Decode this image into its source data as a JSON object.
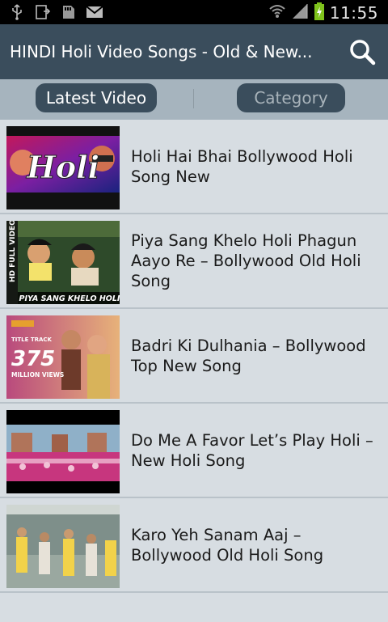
{
  "status_bar": {
    "time": "11:55",
    "icons": [
      "usb-icon",
      "download-icon",
      "sd-card-icon",
      "gmail-icon",
      "wifi-icon",
      "signal-icon",
      "battery-charging-icon"
    ]
  },
  "app_bar": {
    "title": "HINDI Holi Video Songs - Old & New...",
    "search_icon": "search-icon"
  },
  "tabs": [
    {
      "label": "Latest Video",
      "selected": true
    },
    {
      "label": "Category",
      "selected": false
    }
  ],
  "videos": [
    {
      "title": "Holi Hai Bhai Bollywood Holi Song New",
      "thumb_text": "Holi"
    },
    {
      "title": "Piya Sang Khelo Holi Phagun Aayo Re – Bollywood Old Holi Song",
      "thumb_text": "PIYA SANG KHELO HOLI",
      "thumb_side_text": "HD FULL VIDEO"
    },
    {
      "title": "Badri Ki Dulhania – Bollywood Top New Song",
      "thumb_text": "375",
      "thumb_sub_text": "MILLION VIEWS",
      "thumb_badge": "TITLE TRACK"
    },
    {
      "title": "Do Me A Favor Let’s Play Holi – New Holi Song"
    },
    {
      "title": "Karo Yeh Sanam Aaj – Bollywood Old Holi Song"
    }
  ]
}
